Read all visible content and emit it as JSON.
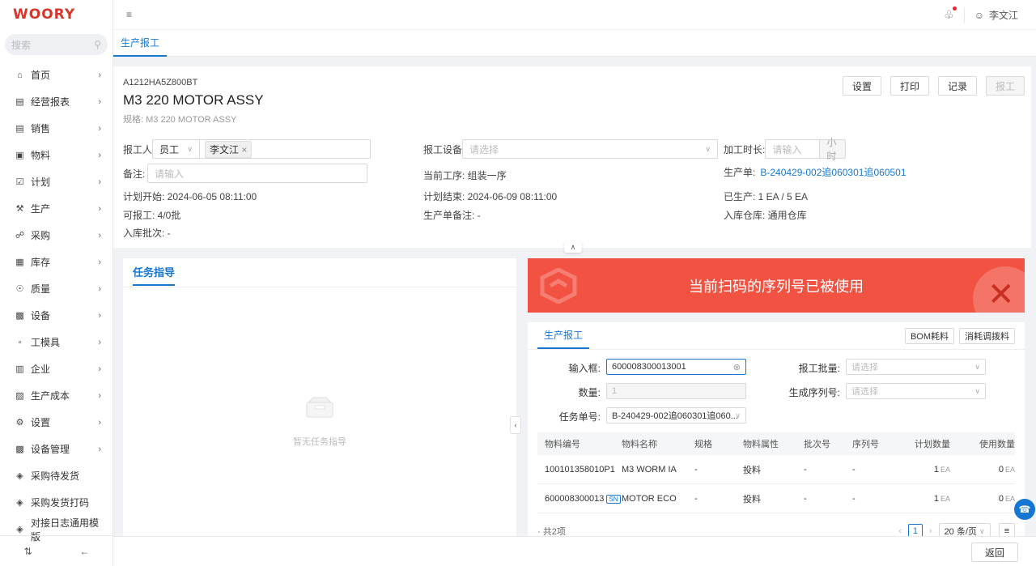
{
  "app": {
    "logo": "WOORY"
  },
  "search": {
    "placeholder": "搜索"
  },
  "sidebar": {
    "items": [
      {
        "label": "首页",
        "icon": "home-icon",
        "sub": true
      },
      {
        "label": "经营报表",
        "icon": "report-icon",
        "sub": true
      },
      {
        "label": "销售",
        "icon": "sales-icon",
        "sub": true
      },
      {
        "label": "物料",
        "icon": "material-icon",
        "sub": true
      },
      {
        "label": "计划",
        "icon": "plan-icon",
        "sub": true
      },
      {
        "label": "生产",
        "icon": "wrench-icon",
        "sub": true
      },
      {
        "label": "采购",
        "icon": "cart-icon",
        "sub": true
      },
      {
        "label": "库存",
        "icon": "warehouse-icon",
        "sub": true
      },
      {
        "label": "质量",
        "icon": "shield-icon",
        "sub": true
      },
      {
        "label": "设备",
        "icon": "device-icon",
        "sub": true
      },
      {
        "label": "工模具",
        "icon": "tool-icon",
        "sub": true
      },
      {
        "label": "企业",
        "icon": "building-icon",
        "sub": true
      },
      {
        "label": "生产成本",
        "icon": "cost-icon",
        "sub": true
      },
      {
        "label": "设置",
        "icon": "gear-icon",
        "sub": true
      },
      {
        "label": "设备管理",
        "icon": "device-manage-icon",
        "sub": true
      },
      {
        "label": "采购待发货",
        "icon": "box-icon",
        "sub": false
      },
      {
        "label": "采购发货打码",
        "icon": "box-icon",
        "sub": false
      },
      {
        "label": "对接日志通用模版",
        "icon": "box-icon",
        "sub": false
      }
    ]
  },
  "topbar": {
    "user": "李文江"
  },
  "tabs": {
    "active": "生产报工"
  },
  "header": {
    "code": "A1212HA5Z800BT",
    "title": "M3 220 MOTOR ASSY",
    "spec": "规格: M3 220 MOTOR ASSY",
    "buttons": {
      "settings": "设置",
      "print": "打印",
      "record": "记录",
      "report": "报工"
    }
  },
  "form": {
    "reporter_label": "报工人",
    "reporter_type": "员工",
    "reporter_tag": "李文江",
    "equipment_label": "报工设备",
    "equipment_placeholder": "请选择",
    "duration_label": "加工时长:",
    "duration_placeholder": "请输入",
    "duration_unit": "小时",
    "remark_label": "备注:",
    "remark_placeholder": "请输入",
    "current_process": "当前工序:  组装一序",
    "production_order_label": "生产单:",
    "production_order": "B-240429-002追060301追060501",
    "plan_start": "计划开始:  2024-06-05 08:11:00",
    "plan_end": "计划结束:  2024-06-09 08:11:00",
    "produced": "已生产:  1 EA / 5 EA",
    "reportable": "可报工:  4/0批",
    "order_remark": "生产单备注:  -",
    "warehouse": "入库仓库:  通用仓库",
    "batch": "入库批次:  -"
  },
  "task_panel": {
    "title": "任务指导",
    "empty": "暂无任务指导"
  },
  "alert": {
    "message": "当前扫码的序列号已被使用"
  },
  "report_panel": {
    "tab": "生产报工",
    "bom_btn": "BOM耗料",
    "consume_btn": "消耗调拨料",
    "input_label": "输入框:",
    "input_value": "600008300013001",
    "batch_qty_label": "报工批量:",
    "batch_qty_placeholder": "请选择",
    "qty_label": "数量:",
    "qty_value": "1",
    "serial_label": "生成序列号:",
    "serial_placeholder": "请选择",
    "task_label": "任务单号:",
    "task_value": "B-240429-002追060301追060..."
  },
  "table": {
    "headers": [
      "物料编号",
      "物料名称",
      "规格",
      "物料属性",
      "批次号",
      "序列号",
      "计划数量",
      "使用数量"
    ],
    "rows": [
      {
        "code": "100101358010P1",
        "sn": "",
        "name": "M3 WORM IA",
        "spec": "-",
        "attr": "投料",
        "batch": "-",
        "serial": "-",
        "plan": "1",
        "plan_unit": "EA",
        "used": "0",
        "used_unit": "EA"
      },
      {
        "code": "600008300013",
        "sn": "SN",
        "name": "MOTOR ECO",
        "spec": "-",
        "attr": "投料",
        "batch": "-",
        "serial": "-",
        "plan": "1",
        "plan_unit": "EA",
        "used": "0",
        "used_unit": "EA"
      }
    ]
  },
  "pager": {
    "total": "· 共2项",
    "page": "1",
    "size": "20 条/页"
  },
  "footer": {
    "back": "返回"
  }
}
